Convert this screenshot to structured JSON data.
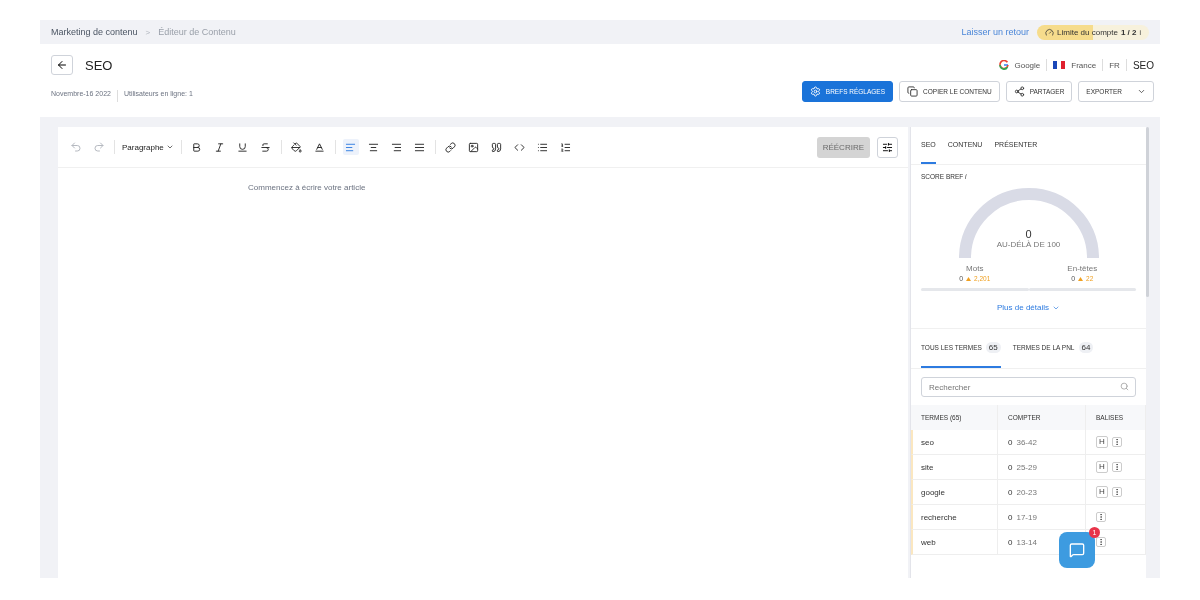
{
  "breadcrumb": [
    {
      "label": "Marketing de contenu",
      "current": false
    },
    {
      "label": "Éditeur de Contenu",
      "current": true
    }
  ],
  "breadcrumb_separator": ">",
  "top_links": {
    "feedback": "Laisser un retour",
    "limit_label": "Limite du compte",
    "limit_value": "1 / 2",
    "limit_info": "i",
    "level": 0.5
  },
  "title": "SEO",
  "meta": {
    "date": "Novembre-16 2022",
    "users": "Utilisateurs en ligne: 1"
  },
  "context": [
    {
      "kind": "google",
      "label": "Google"
    },
    {
      "kind": "flag",
      "label": "France"
    },
    {
      "kind": "plain",
      "label": "FR"
    },
    {
      "kind": "strong",
      "label": "SEO"
    }
  ],
  "actions": [
    {
      "kind": "primary",
      "label": "BREFS RÉGLAGES"
    },
    {
      "kind": "copy",
      "label": "COPIER LE CONTENU"
    },
    {
      "kind": "share",
      "label": "PARTAGER"
    },
    {
      "kind": "dropdown",
      "label": "EXPORTER"
    }
  ],
  "toolbar": {
    "block_style": "Paragraphe",
    "rewrite": "RÉÉCRIRE",
    "rewrite_disabled": true,
    "align": [
      {
        "selected": true
      },
      {
        "selected": false
      },
      {
        "selected": false
      },
      {
        "selected": false
      }
    ]
  },
  "editor": {
    "placeholder": "Commencez à écrire votre article"
  },
  "panel_tabs": [
    {
      "label": "SEO",
      "selected": true
    },
    {
      "label": "CONTENU",
      "selected": false
    },
    {
      "label": "PRÉSENTER",
      "selected": false
    }
  ],
  "score": {
    "title": "SCORE BREF",
    "info": "i",
    "value": "0",
    "caption": "AU-DÉLÀ DE 100"
  },
  "stats": [
    {
      "label": "Mots",
      "value": "0",
      "target": "2,201"
    },
    {
      "label": "En-têtes",
      "value": "0",
      "target": "22"
    }
  ],
  "more_details": "Plus de détails",
  "term_tabs": [
    {
      "label": "TOUS LES TERMES",
      "count": "65",
      "selected": true
    },
    {
      "label": "TERMES DE LA PNL",
      "count": "64",
      "selected": false
    }
  ],
  "search": {
    "placeholder": "Rechercher"
  },
  "table": {
    "columns": [
      "TERMES (65)",
      "COMPTER",
      "BALISES"
    ],
    "rows": [
      {
        "term": "seo",
        "count": "0",
        "range": "36-42",
        "tag": "H"
      },
      {
        "term": "site",
        "count": "0",
        "range": "25-29",
        "tag": "H"
      },
      {
        "term": "google",
        "count": "0",
        "range": "20-23",
        "tag": "H"
      },
      {
        "term": "recherche",
        "count": "0",
        "range": "17-19"
      },
      {
        "term": "web",
        "count": "0",
        "range": "13-14"
      }
    ]
  },
  "chat": {
    "badge": "1"
  }
}
